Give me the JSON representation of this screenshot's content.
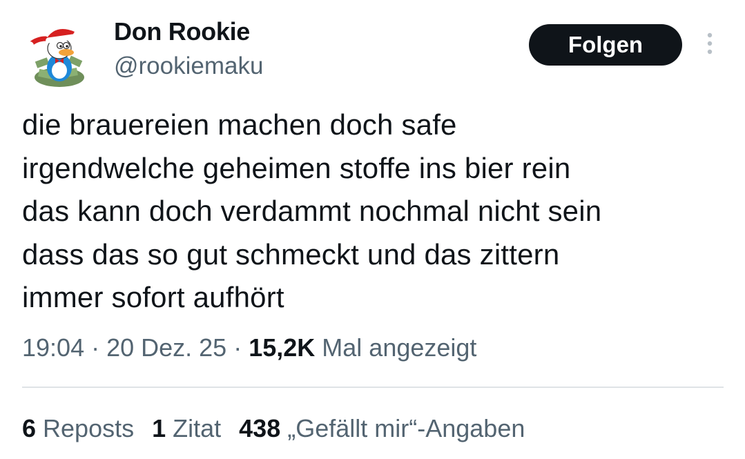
{
  "author": {
    "display_name": "Don Rookie",
    "handle": "@rookiemaku",
    "avatar_icon": "cartoon-duck-santa-hat-avatar"
  },
  "header": {
    "follow_label": "Folgen",
    "more_icon": "more-vertical-icon"
  },
  "tweet": {
    "lines": [
      "die brauereien machen doch safe",
      "irgendwelche geheimen stoffe ins bier rein",
      "das kann doch verdammt nochmal nicht sein",
      "dass das so gut schmeckt und das zittern",
      "immer sofort aufhört"
    ]
  },
  "meta": {
    "time": "19:04",
    "separator": " · ",
    "date": "20 Dez. 25",
    "views_count": "15,2K",
    "views_label": " Mal angezeigt"
  },
  "stats": {
    "reposts_count": "6",
    "reposts_label": " Reposts",
    "quotes_count": "1",
    "quotes_label": " Zitat",
    "likes_count": "438",
    "likes_label": " „Gefällt mir“-Angaben"
  },
  "colors": {
    "text_primary": "#0f1419",
    "text_secondary": "#536471",
    "divider": "#dfe3e6",
    "button_bg": "#0f1419",
    "button_text": "#ffffff"
  }
}
